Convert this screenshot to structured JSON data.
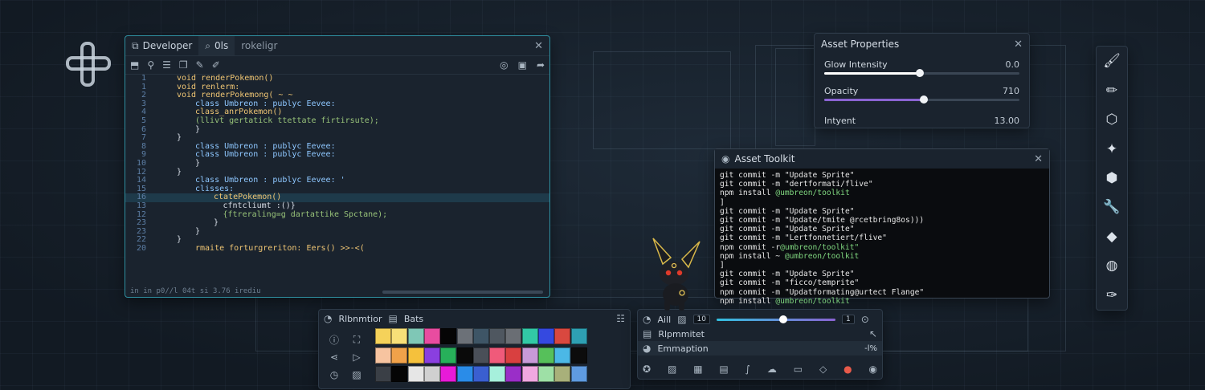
{
  "colors": {
    "accent": "#2f8fa0",
    "slider_white": "#ffffff",
    "slider_purple": "#8a63d2",
    "cyan": "#33c0e0"
  },
  "editor": {
    "tabs": [
      {
        "label": "Developer",
        "icon": "developer-icon"
      },
      {
        "label": "0ls",
        "icon": "search-icon"
      },
      {
        "label": "rokeligr",
        "icon": ""
      }
    ],
    "code": [
      {
        "n": "1",
        "t": "void renderPokemon()",
        "i": 0,
        "c": "fn"
      },
      {
        "n": "1",
        "t": "void renlerm:",
        "i": 0,
        "c": "fn"
      },
      {
        "n": "2",
        "t": "void renderPokemong( ~ ~",
        "i": 0,
        "c": "fn"
      },
      {
        "n": "3",
        "t": "class Umbreon : publyc Eevee:",
        "i": 2,
        "c": "kw"
      },
      {
        "n": "4",
        "t": "class_anrPokemon()",
        "i": 2,
        "c": "fn"
      },
      {
        "n": "5",
        "t": "(llivt gertatick ttettate firtirsute);",
        "i": 2,
        "c": "str"
      },
      {
        "n": "6",
        "t": "}",
        "i": 2,
        "c": "pl"
      },
      {
        "n": "7",
        "t": "}",
        "i": 0,
        "c": "pl"
      },
      {
        "n": "8",
        "t": "class Umbreon : publyc Eevee:",
        "i": 2,
        "c": "kw"
      },
      {
        "n": "9",
        "t": "class Umbreon : publyc Eevee:",
        "i": 2,
        "c": "kw"
      },
      {
        "n": "10",
        "t": "}",
        "i": 2,
        "c": "pl"
      },
      {
        "n": "12",
        "t": "}",
        "i": 0,
        "c": "pl"
      },
      {
        "n": "14",
        "t": "class Umbreon : publyc Eevee: '",
        "i": 2,
        "c": "kw"
      },
      {
        "n": "15",
        "t": "clisses:",
        "i": 2,
        "c": "kw"
      },
      {
        "n": "16",
        "t": "ctatePokemon()",
        "i": 4,
        "c": "fn",
        "hl": true
      },
      {
        "n": "13",
        "t": "cfntcliumt :()}",
        "i": 5,
        "c": "pl"
      },
      {
        "n": "12",
        "t": "{ftreraling=g dartattike Spctane);",
        "i": 5,
        "c": "str"
      },
      {
        "n": "23",
        "t": "}",
        "i": 4,
        "c": "pl"
      },
      {
        "n": "23",
        "t": "}",
        "i": 2,
        "c": "pl"
      },
      {
        "n": "22",
        "t": "}",
        "i": 0,
        "c": "pl"
      },
      {
        "n": "20",
        "t": "rmaite forturgreriton: Eers() >>-<(",
        "i": 2,
        "c": "fn"
      }
    ],
    "status": "in in p0//l 04t si 3.76 irediu"
  },
  "props": {
    "title": "Asset Properties",
    "rows": [
      {
        "label": "Glow Intensity",
        "value": "0.0",
        "pct": 0.49,
        "color": "#ffffff"
      },
      {
        "label": "Opacity",
        "value": "710",
        "pct": 0.51,
        "color": "#8a63d2"
      },
      {
        "label": "Intyent",
        "value": "13.00"
      }
    ]
  },
  "terminal": {
    "title": "Asset Toolkit",
    "lines": [
      [
        "git commit -m \"Update Sprite\"",
        ""
      ],
      [
        "git commit -m \"dertformati/flive\"",
        ""
      ],
      [
        "npm install ",
        "@umbreon/toolkit"
      ],
      [
        "]",
        ""
      ],
      [
        "git commit -m \"Update Sprite\"",
        ""
      ],
      [
        "git commit -m \"Update/tmite @rcetbring8os)))",
        ""
      ],
      [
        "git commit -m \"Update Sprite\"",
        ""
      ],
      [
        "git commit -m \"Lertfonnetiert/flive\"",
        ""
      ],
      [
        "npm commit -r",
        "@umbreon/toolkit\""
      ],
      [
        "npm install ~ ",
        "@umbreon/toolkit"
      ],
      [
        "]",
        ""
      ],
      [
        "git commit -m \"Update Sprite\"",
        ""
      ],
      [
        "git commit -m \"ficco/temprite\"",
        ""
      ],
      [
        "npm commit -m \"Updatformating@urtect Flange\"",
        ""
      ],
      [
        "npm install ",
        "@umbreon/toolkit"
      ]
    ]
  },
  "colorpanel": {
    "tab1": "Rlbnmtior",
    "tab2": "Bats",
    "swatches": [
      [
        "#f5d25a",
        "#f7e078",
        "#7fc7b6",
        "#e84ca0",
        "#050505",
        "#6c7178",
        "#3e5566",
        "#4f5760",
        "#6a6e74",
        "#32c9a6",
        "#3549e0",
        "#d9483f",
        "#2ea0b3"
      ],
      [
        "#f7c4a0",
        "#f0a24a",
        "#f5c13c",
        "#8a3fe0",
        "#27b05a",
        "#0a0a0a",
        "#4a4f58",
        "#f05a7a",
        "#d94040",
        "#c89ad8",
        "#56c05a",
        "#4bb8e6",
        "#0c0c0c"
      ],
      [
        "#3a3f46",
        "#050505",
        "#e6e6e6",
        "#d0d0d0",
        "#e81ad8",
        "#2a8ce8",
        "#3a5fd0",
        "#a6f0dc",
        "#9a2ec8",
        "#f0a8e0",
        "#9ee0a6",
        "#a8b07a",
        "#5f9be0"
      ]
    ]
  },
  "controls": {
    "label1": "Aill",
    "num1": "10",
    "num2": "1",
    "pct": 0.56,
    "label2": "Rlpmmitet",
    "label3": "Emmaption",
    "label3val": "-l%"
  }
}
